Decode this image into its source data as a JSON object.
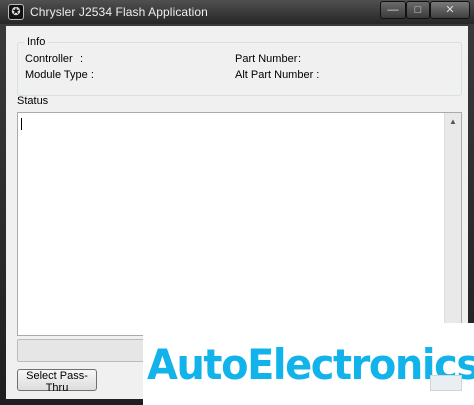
{
  "window": {
    "title": "Chrysler J2534 Flash Application",
    "controls": {
      "minimize": "—",
      "maximize": "□",
      "close": "✕"
    }
  },
  "info": {
    "group_label": "Info",
    "controller_label": "Controller",
    "controller_sep": ":",
    "module_type_label": "Module Type :",
    "part_number_label": "Part Number",
    "part_number_sep": ":",
    "alt_part_number_label": "Alt Part Number :"
  },
  "status": {
    "label": "Status",
    "text": ""
  },
  "buttons": {
    "select_pass_thru": "Select Pass-Thru"
  },
  "watermark": {
    "text": "AutoElectronics"
  },
  "icons": [
    "app-icon",
    "minimize-icon",
    "maximize-icon",
    "close-icon",
    "scroll-up-icon",
    "scroll-down-icon"
  ]
}
